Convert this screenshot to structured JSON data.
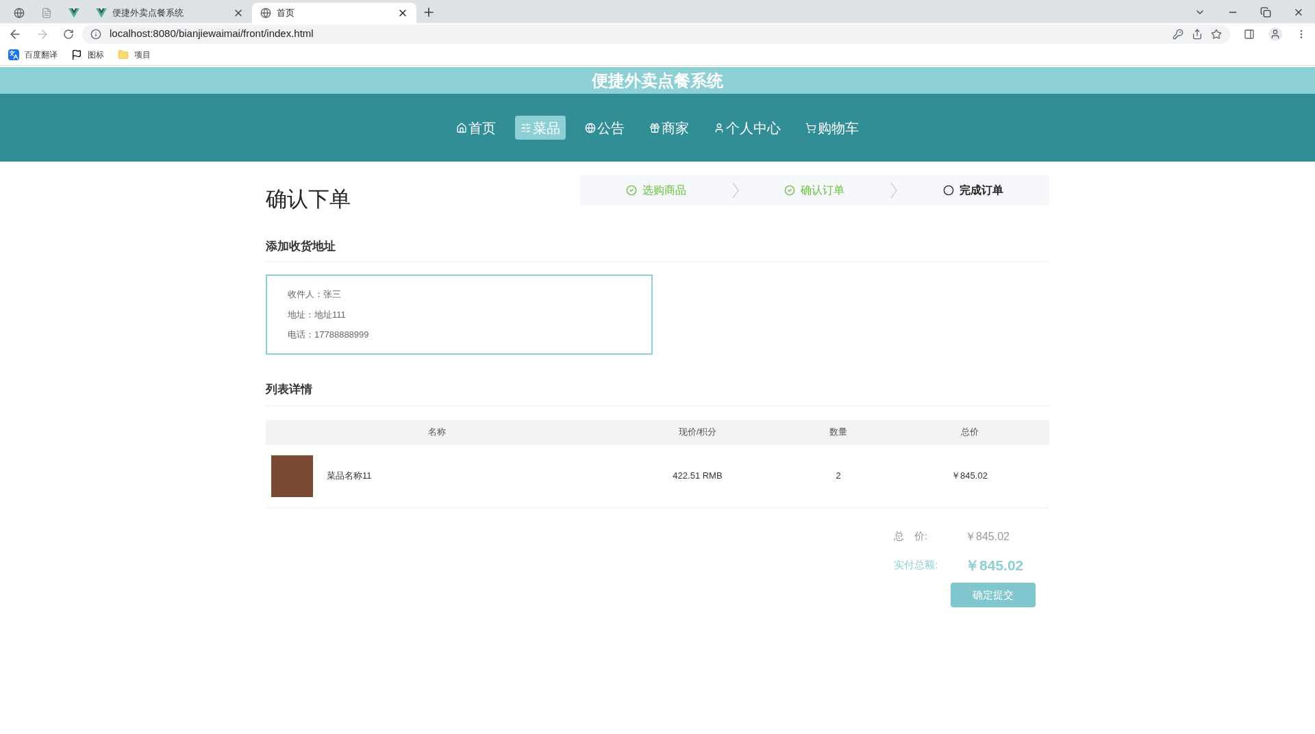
{
  "browser": {
    "tabs": [
      {
        "kind": "globe",
        "selected": false
      },
      {
        "kind": "page",
        "selected": false
      },
      {
        "kind": "vue",
        "selected": false
      },
      {
        "kind": "vue",
        "title": "便捷外卖点餐系统",
        "selected": false
      },
      {
        "kind": "globe",
        "title": "首页",
        "selected": true
      }
    ],
    "url": "localhost:8080/bianjiewaimai/front/index.html",
    "bookmarks": [
      {
        "kind": "translate",
        "label": "百度翻译"
      },
      {
        "kind": "flag",
        "label": "图标"
      },
      {
        "kind": "folder",
        "label": "项目"
      }
    ]
  },
  "site_title": "便捷外卖点餐系统",
  "nav": [
    {
      "kind": "home",
      "label": "首页",
      "selected": false
    },
    {
      "kind": "sliders",
      "label": "菜品",
      "selected": true
    },
    {
      "kind": "globe",
      "label": "公告",
      "selected": false
    },
    {
      "kind": "gift",
      "label": "商家",
      "selected": false
    },
    {
      "kind": "user",
      "label": "个人中心",
      "selected": false
    },
    {
      "kind": "cart",
      "label": "购物车",
      "selected": false
    }
  ],
  "page_title": "确认下单",
  "steps": [
    {
      "label": "选购商品",
      "done": true
    },
    {
      "label": "确认订单",
      "done": true
    },
    {
      "label": "完成订单",
      "done": false
    }
  ],
  "address_section": {
    "title": "添加收货地址",
    "lines": [
      "收件人：张三",
      "地址：地址111",
      "电话：17788888999"
    ]
  },
  "list_section": {
    "title": "列表详情",
    "columns": [
      "名称",
      "现价/积分",
      "数量",
      "总价"
    ],
    "rows": [
      {
        "name": "菜品名称11",
        "price": "422.51 RMB",
        "quantity": "2",
        "total": "￥845.02"
      }
    ]
  },
  "summary": {
    "total_label": "总　价:",
    "total": "￥845.02",
    "paid_label": "实付总额:",
    "paid": "￥845.02",
    "submit": "确定提交"
  }
}
